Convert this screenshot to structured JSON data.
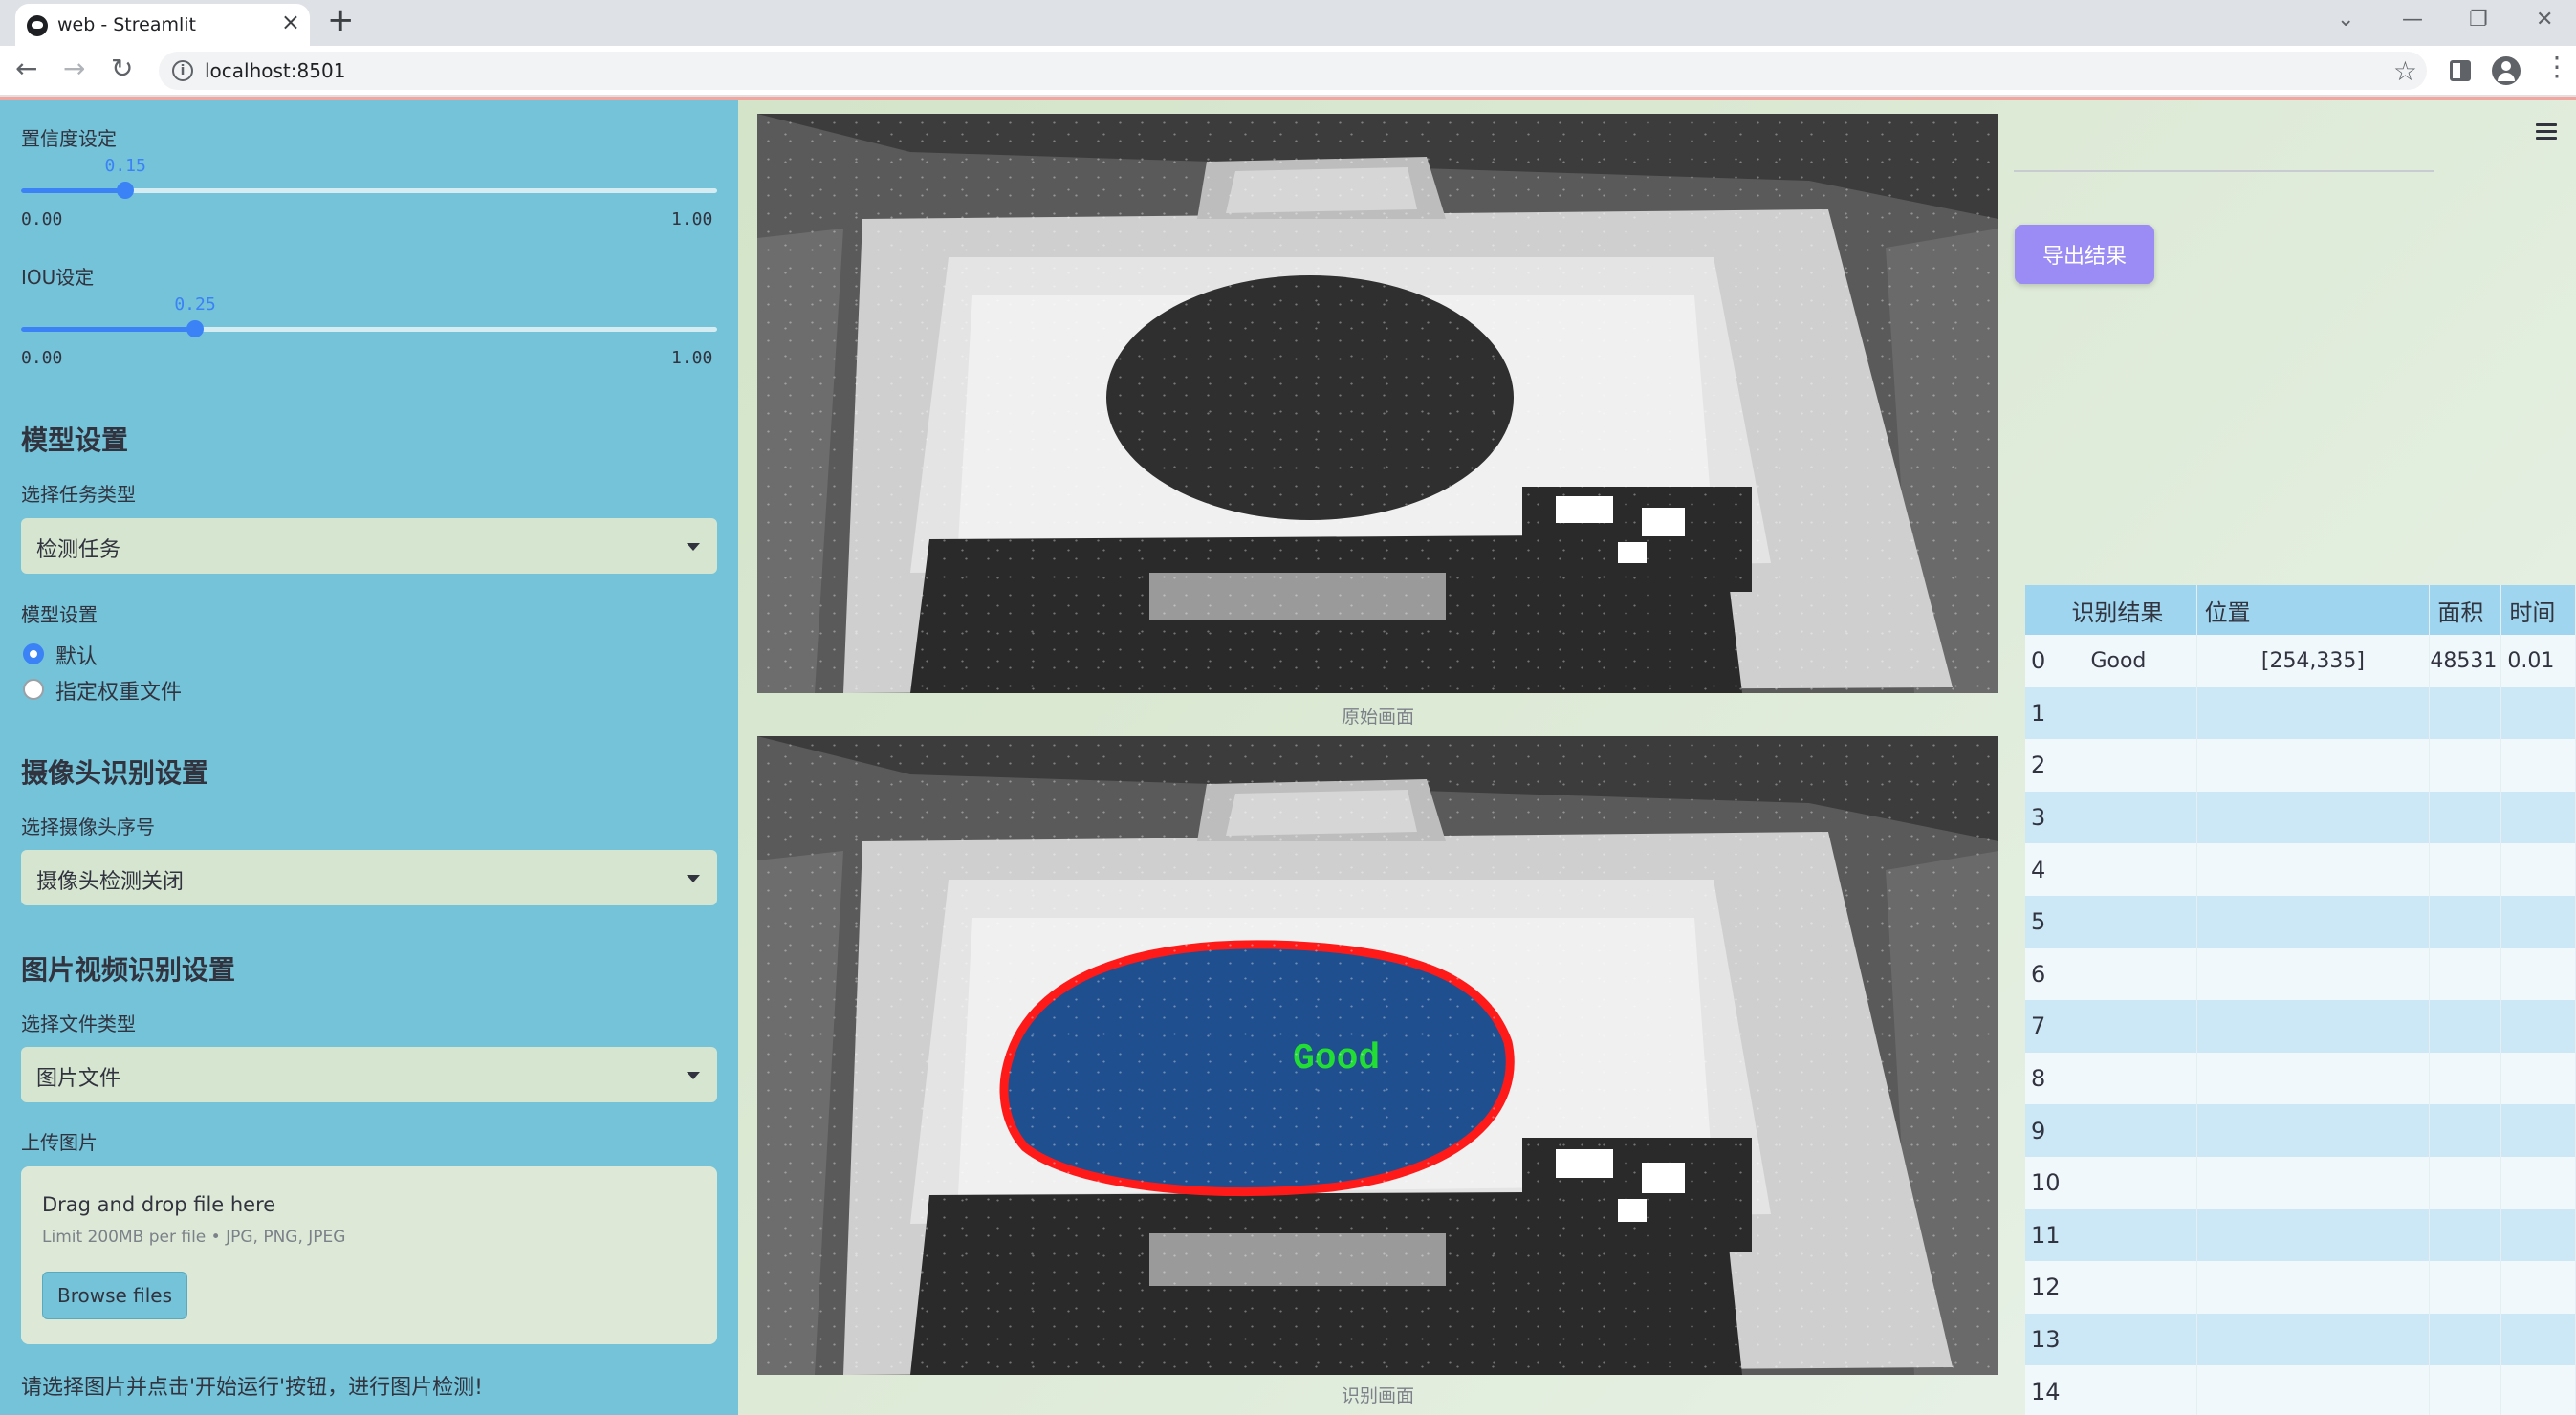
{
  "browser": {
    "tab_title": "web - Streamlit",
    "url": "localhost:8501"
  },
  "sidebar": {
    "confidence": {
      "label": "置信度设定",
      "value": 0.15,
      "value_text": "0.15",
      "min_text": "0.00",
      "max_text": "1.00"
    },
    "iou": {
      "label": "IOU设定",
      "value": 0.25,
      "value_text": "0.25",
      "min_text": "0.00",
      "max_text": "1.00"
    },
    "model_section": {
      "heading": "模型设置",
      "task_label": "选择任务类型",
      "task_value": "检测任务",
      "weights_label": "模型设置",
      "weights_options": [
        {
          "label": "默认",
          "selected": true
        },
        {
          "label": "指定权重文件",
          "selected": false
        }
      ]
    },
    "camera_section": {
      "heading": "摄像头识别设置",
      "camera_label": "选择摄像头序号",
      "camera_value": "摄像头检测关闭"
    },
    "file_section": {
      "heading": "图片视频识别设置",
      "type_label": "选择文件类型",
      "type_value": "图片文件",
      "upload_label": "上传图片",
      "drop_text": "Drag and drop file here",
      "limit_text": "Limit 200MB per file • JPG, PNG, JPEG",
      "browse_label": "Browse files"
    },
    "hint": "请选择图片并点击'开始运行'按钮，进行图片检测!"
  },
  "main": {
    "original_caption": "原始画面",
    "result_caption": "识别画面",
    "detection_label": "Good",
    "export_label": "导出结果",
    "colors": {
      "detection_outline": "#ff1a1a",
      "detection_fill": "#1f4f8f",
      "detection_text": "#22dd33",
      "accent": "#9b8bf4"
    }
  },
  "table": {
    "headers": [
      "",
      "识别结果",
      "位置",
      "面积",
      "时间"
    ],
    "rows": [
      {
        "idx": "0",
        "result": "Good",
        "position": "[254,335]",
        "area": "48531",
        "time": "0.01"
      },
      {
        "idx": "1",
        "result": "",
        "position": "",
        "area": "",
        "time": ""
      },
      {
        "idx": "2",
        "result": "",
        "position": "",
        "area": "",
        "time": ""
      },
      {
        "idx": "3",
        "result": "",
        "position": "",
        "area": "",
        "time": ""
      },
      {
        "idx": "4",
        "result": "",
        "position": "",
        "area": "",
        "time": ""
      },
      {
        "idx": "5",
        "result": "",
        "position": "",
        "area": "",
        "time": ""
      },
      {
        "idx": "6",
        "result": "",
        "position": "",
        "area": "",
        "time": ""
      },
      {
        "idx": "7",
        "result": "",
        "position": "",
        "area": "",
        "time": ""
      },
      {
        "idx": "8",
        "result": "",
        "position": "",
        "area": "",
        "time": ""
      },
      {
        "idx": "9",
        "result": "",
        "position": "",
        "area": "",
        "time": ""
      },
      {
        "idx": "10",
        "result": "",
        "position": "",
        "area": "",
        "time": ""
      },
      {
        "idx": "11",
        "result": "",
        "position": "",
        "area": "",
        "time": ""
      },
      {
        "idx": "12",
        "result": "",
        "position": "",
        "area": "",
        "time": ""
      },
      {
        "idx": "13",
        "result": "",
        "position": "",
        "area": "",
        "time": ""
      },
      {
        "idx": "14",
        "result": "",
        "position": "",
        "area": "",
        "time": ""
      }
    ]
  }
}
